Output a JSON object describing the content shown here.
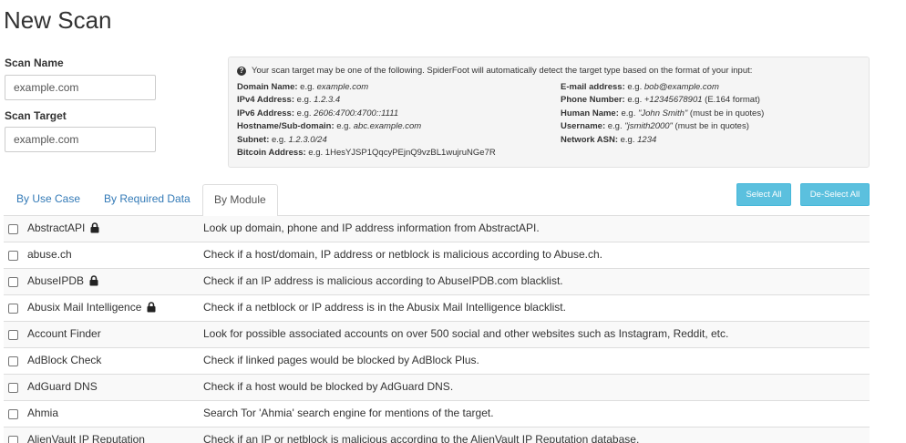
{
  "page": {
    "title": "New Scan"
  },
  "form": {
    "scan_name_label": "Scan Name",
    "scan_name_placeholder": "example.com",
    "scan_target_label": "Scan Target",
    "scan_target_placeholder": "example.com"
  },
  "help": {
    "intro": "Your scan target may be one of the following. SpiderFoot will automatically detect the target type based on the format of your input:",
    "left": [
      {
        "label": "Domain Name:",
        "prefix": " e.g. ",
        "example": "example.com",
        "suffix": ""
      },
      {
        "label": "IPv4 Address:",
        "prefix": " e.g. ",
        "example": "1.2.3.4",
        "suffix": ""
      },
      {
        "label": "IPv6 Address:",
        "prefix": " e.g. ",
        "example": "2606:4700:4700::1111",
        "suffix": ""
      },
      {
        "label": "Hostname/Sub-domain:",
        "prefix": " e.g. ",
        "example": "abc.example.com",
        "suffix": ""
      },
      {
        "label": "Subnet:",
        "prefix": " e.g. ",
        "example": "1.2.3.0/24",
        "suffix": ""
      },
      {
        "label": "Bitcoin Address:",
        "prefix": " e.g. 1HesYJSP1QqcyPEjnQ9vzBL1wujruNGe7R",
        "example": "",
        "suffix": ""
      }
    ],
    "right": [
      {
        "label": "E-mail address:",
        "prefix": " e.g. ",
        "example": "bob@example.com",
        "suffix": ""
      },
      {
        "label": "Phone Number:",
        "prefix": " e.g. ",
        "example": "+12345678901",
        "suffix": " (E.164 format)"
      },
      {
        "label": "Human Name:",
        "prefix": " e.g. ",
        "example": "\"John Smith\"",
        "suffix": " (must be in quotes)"
      },
      {
        "label": "Username:",
        "prefix": " e.g. ",
        "example": "\"jsmith2000\"",
        "suffix": " (must be in quotes)"
      },
      {
        "label": "Network ASN:",
        "prefix": " e.g. ",
        "example": "1234",
        "suffix": ""
      }
    ]
  },
  "tabs": {
    "use_case": "By Use Case",
    "required_data": "By Required Data",
    "module": "By Module",
    "active": "By Module"
  },
  "buttons": {
    "select_all": "Select All",
    "deselect_all": "De-Select All"
  },
  "colors": {
    "link": "#337ab7",
    "button_info": "#5bc0de"
  },
  "modules": [
    {
      "name": "AbstractAPI",
      "locked": true,
      "description": "Look up domain, phone and IP address information from AbstractAPI."
    },
    {
      "name": "abuse.ch",
      "locked": false,
      "description": "Check if a host/domain, IP address or netblock is malicious according to Abuse.ch."
    },
    {
      "name": "AbuseIPDB",
      "locked": true,
      "description": "Check if an IP address is malicious according to AbuseIPDB.com blacklist."
    },
    {
      "name": "Abusix Mail Intelligence",
      "locked": true,
      "description": "Check if a netblock or IP address is in the Abusix Mail Intelligence blacklist."
    },
    {
      "name": "Account Finder",
      "locked": false,
      "description": "Look for possible associated accounts on over 500 social and other websites such as Instagram, Reddit, etc."
    },
    {
      "name": "AdBlock Check",
      "locked": false,
      "description": "Check if linked pages would be blocked by AdBlock Plus."
    },
    {
      "name": "AdGuard DNS",
      "locked": false,
      "description": "Check if a host would be blocked by AdGuard DNS."
    },
    {
      "name": "Ahmia",
      "locked": false,
      "description": "Search Tor 'Ahmia' search engine for mentions of the target."
    },
    {
      "name": "AlienVault IP Reputation",
      "locked": false,
      "description": "Check if an IP or netblock is malicious according to the AlienVault IP Reputation database."
    }
  ]
}
